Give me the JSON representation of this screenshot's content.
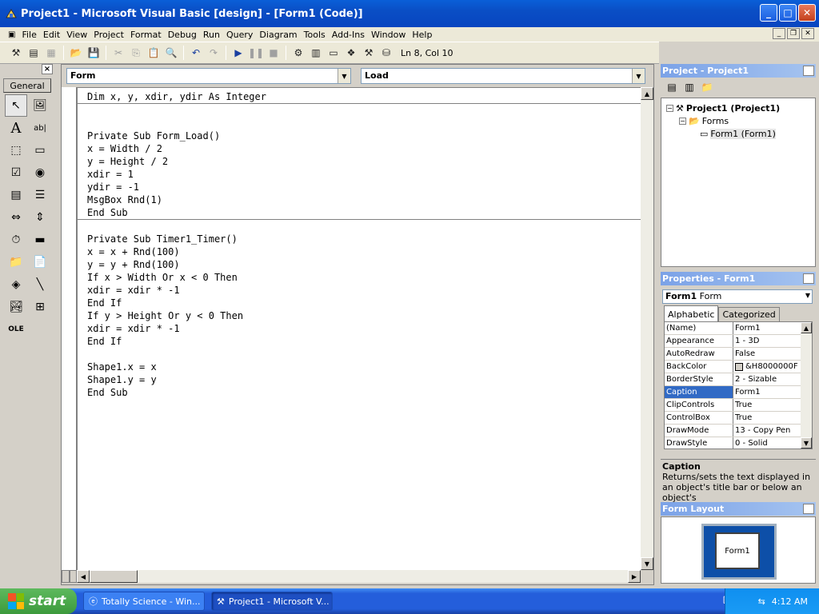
{
  "title": "Project1 - Microsoft Visual Basic [design] - [Form1 (Code)]",
  "menu": [
    "File",
    "Edit",
    "View",
    "Project",
    "Format",
    "Debug",
    "Run",
    "Query",
    "Diagram",
    "Tools",
    "Add-Ins",
    "Window",
    "Help"
  ],
  "toolbar": {
    "position": "Ln 8, Col 10"
  },
  "toolbox": {
    "tab_label": "General",
    "x": "×"
  },
  "code": {
    "object_combo": "Form",
    "proc_combo": "Load",
    "lines": [
      "Dim x, y, xdir, ydir As Integer",
      "",
      "",
      "Private Sub Form_Load()",
      "x = Width / 2",
      "y = Height / 2",
      "xdir = 1",
      "ydir = -1",
      "MsgBox Rnd(1)",
      "End Sub",
      "",
      "Private Sub Timer1_Timer()",
      "x = x + Rnd(100)",
      "y = y + Rnd(100)",
      "If x > Width Or x < 0 Then",
      "xdir = xdir * -1",
      "End If",
      "If y > Height Or y < 0 Then",
      "xdir = xdir * -1",
      "End If",
      "",
      "Shape1.x = x",
      "Shape1.y = y",
      "End Sub"
    ]
  },
  "project": {
    "header": "Project - Project1",
    "root": "Project1 (Project1)",
    "folder": "Forms",
    "form": "Form1 (Form1)"
  },
  "properties": {
    "header": "Properties - Form1",
    "object_name": "Form1",
    "object_type": "Form",
    "tabs": [
      "Alphabetic",
      "Categorized"
    ],
    "rows": [
      {
        "name": "(Name)",
        "value": "Form1"
      },
      {
        "name": "Appearance",
        "value": "1 - 3D"
      },
      {
        "name": "AutoRedraw",
        "value": "False"
      },
      {
        "name": "BackColor",
        "value": "&H8000000F"
      },
      {
        "name": "BorderStyle",
        "value": "2 - Sizable"
      },
      {
        "name": "Caption",
        "value": "Form1"
      },
      {
        "name": "ClipControls",
        "value": "True"
      },
      {
        "name": "ControlBox",
        "value": "True"
      },
      {
        "name": "DrawMode",
        "value": "13 - Copy Pen"
      },
      {
        "name": "DrawStyle",
        "value": "0 - Solid"
      }
    ],
    "selected_index": 5,
    "desc_title": "Caption",
    "desc_text": "Returns/sets the text displayed in an object's title bar or below an object's"
  },
  "layout": {
    "header": "Form Layout",
    "form_label": "Form1"
  },
  "taskbar": {
    "start": "start",
    "tasks": [
      {
        "label": "Totally Science - Win...",
        "active": false
      },
      {
        "label": "Project1 - Microsoft V...",
        "active": true
      }
    ],
    "clock": "4:12 AM"
  }
}
